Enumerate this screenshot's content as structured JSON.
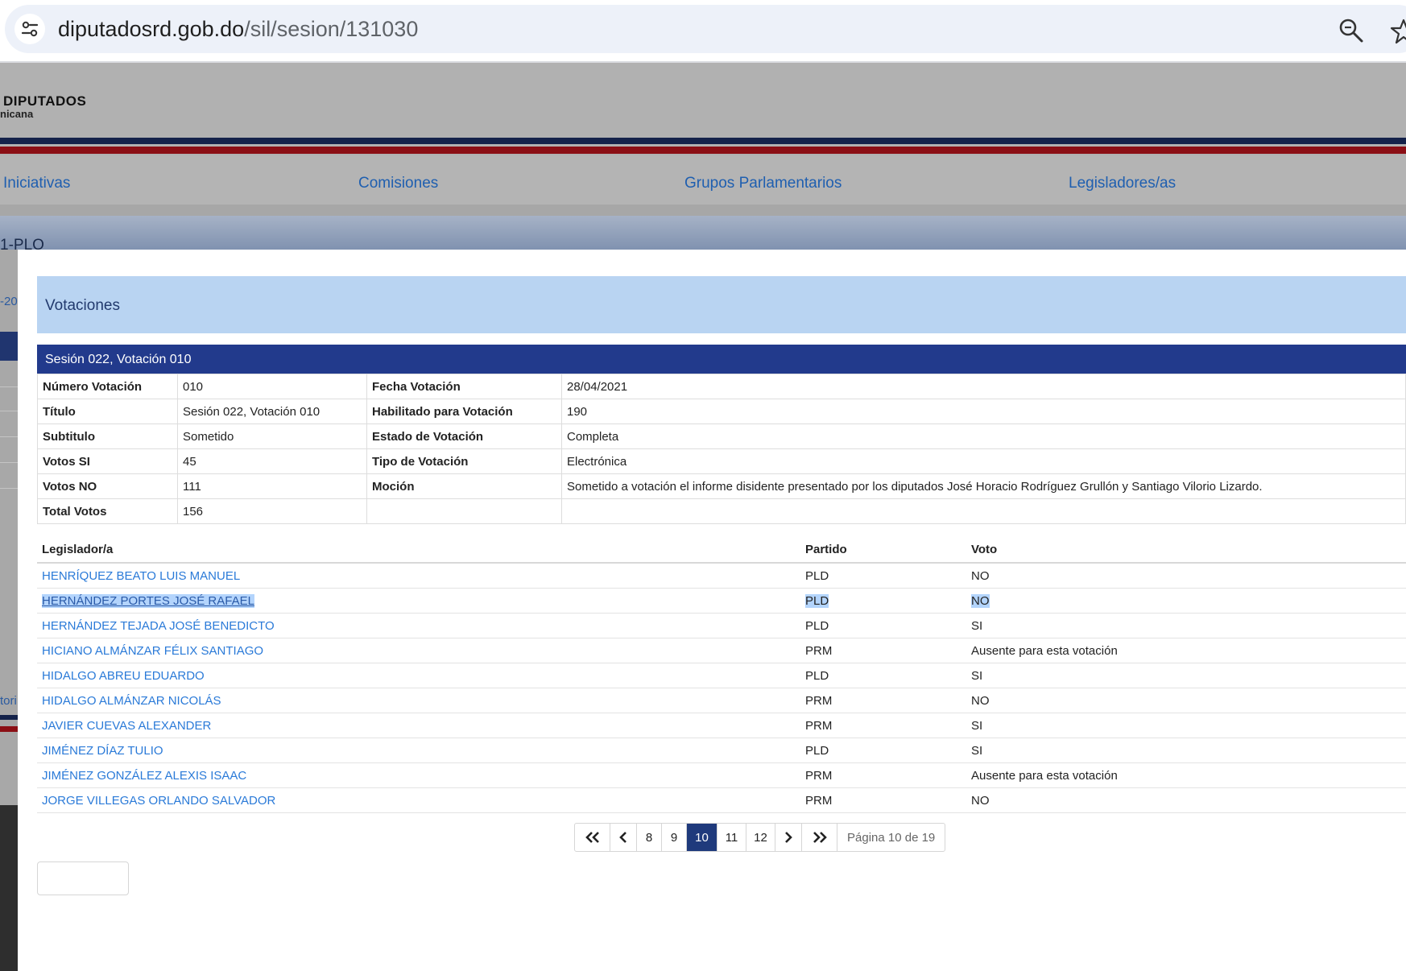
{
  "browser": {
    "url_host": "diputadosrd.gob.do",
    "url_path": "/sil/sesion/131030",
    "icons": [
      "site-controls-icon",
      "zoom-icon",
      "bookmark-star-icon"
    ]
  },
  "site": {
    "logo_main": "DIPUTADOS",
    "logo_sub": "nicana",
    "colors": {
      "stripe_blue": "#14224a",
      "stripe_red": "#8b0f15",
      "link": "#2a7ad8"
    }
  },
  "nav": {
    "items": [
      {
        "label": "Iniciativas"
      },
      {
        "label": "Comisiones"
      },
      {
        "label": "Grupos Parlamentarios"
      },
      {
        "label": "Legisladores/as"
      }
    ]
  },
  "background": {
    "banner_text": "1-PLO",
    "left_text_a": "-20",
    "left_text_b": "tori"
  },
  "panel": {
    "title": "Votaciones",
    "vote_title": "Sesión 022, Votación 010"
  },
  "details": [
    {
      "l1": "Número Votación",
      "v1": "010",
      "l2": "Fecha Votación",
      "v2": "28/04/2021"
    },
    {
      "l1": "Título",
      "v1": "Sesión 022, Votación 010",
      "l2": "Habilitado para Votación",
      "v2": "190"
    },
    {
      "l1": "Subtitulo",
      "v1": "Sometido",
      "l2": "Estado de Votación",
      "v2": "Completa"
    },
    {
      "l1": "Votos SI",
      "v1": "45",
      "l2": "Tipo de Votación",
      "v2": "Electrónica"
    },
    {
      "l1": "Votos NO",
      "v1": "111",
      "l2": "Moción",
      "v2": "Sometido a votación el informe disidente presentado por los diputados José Horacio Rodríguez Grullón y Santiago Vilorio Lizardo."
    },
    {
      "l1": "Total Votos",
      "v1": "156",
      "l2": "",
      "v2": ""
    }
  ],
  "votes": {
    "headers": {
      "legislador": "Legislador/a",
      "partido": "Partido",
      "voto": "Voto"
    },
    "rows": [
      {
        "name": "HENRÍQUEZ BEATO LUIS MANUEL",
        "party": "PLD",
        "vote": "NO"
      },
      {
        "name": "HERNÁNDEZ PORTES JOSÉ RAFAEL",
        "party": "PLD",
        "vote": "NO",
        "selected": true
      },
      {
        "name": "HERNÁNDEZ TEJADA JOSÉ BENEDICTO",
        "party": "PLD",
        "vote": "SI"
      },
      {
        "name": "HICIANO ALMÁNZAR FÉLIX SANTIAGO",
        "party": "PRM",
        "vote": "Ausente para esta votación"
      },
      {
        "name": "HIDALGO ABREU EDUARDO",
        "party": "PLD",
        "vote": "SI"
      },
      {
        "name": "HIDALGO ALMÁNZAR NICOLÁS",
        "party": "PRM",
        "vote": "NO"
      },
      {
        "name": "JAVIER CUEVAS ALEXANDER",
        "party": "PRM",
        "vote": "SI"
      },
      {
        "name": "JIMÉNEZ DÍAZ TULIO",
        "party": "PLD",
        "vote": "SI"
      },
      {
        "name": "JIMÉNEZ GONZÁLEZ ALEXIS ISAAC",
        "party": "PRM",
        "vote": "Ausente para esta votación"
      },
      {
        "name": "JORGE VILLEGAS ORLANDO SALVADOR",
        "party": "PRM",
        "vote": "NO"
      }
    ]
  },
  "pagination": {
    "pages": [
      "8",
      "9",
      "10",
      "11",
      "12"
    ],
    "current": "10",
    "info": "Página 10 de 19",
    "icons": [
      "first-page-icon",
      "prev-page-icon",
      "next-page-icon",
      "last-page-icon"
    ]
  }
}
